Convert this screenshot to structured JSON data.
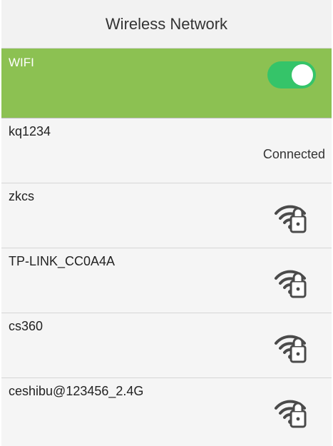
{
  "header": {
    "title": "Wireless Network"
  },
  "wifi": {
    "label": "WIFI",
    "enabled": true,
    "toggle_color": "#35c469",
    "bar_color": "#8cc152"
  },
  "networks": [
    {
      "ssid": "kq1234",
      "status": "Connected",
      "icon": null
    },
    {
      "ssid": "zkcs",
      "status": null,
      "icon": "wifi-lock-icon"
    },
    {
      "ssid": "TP-LINK_CC0A4A",
      "status": null,
      "icon": "wifi-lock-icon"
    },
    {
      "ssid": "cs360",
      "status": null,
      "icon": "wifi-lock-icon"
    },
    {
      "ssid": "ceshibu@123456_2.4G",
      "status": null,
      "icon": "wifi-lock-icon"
    }
  ]
}
